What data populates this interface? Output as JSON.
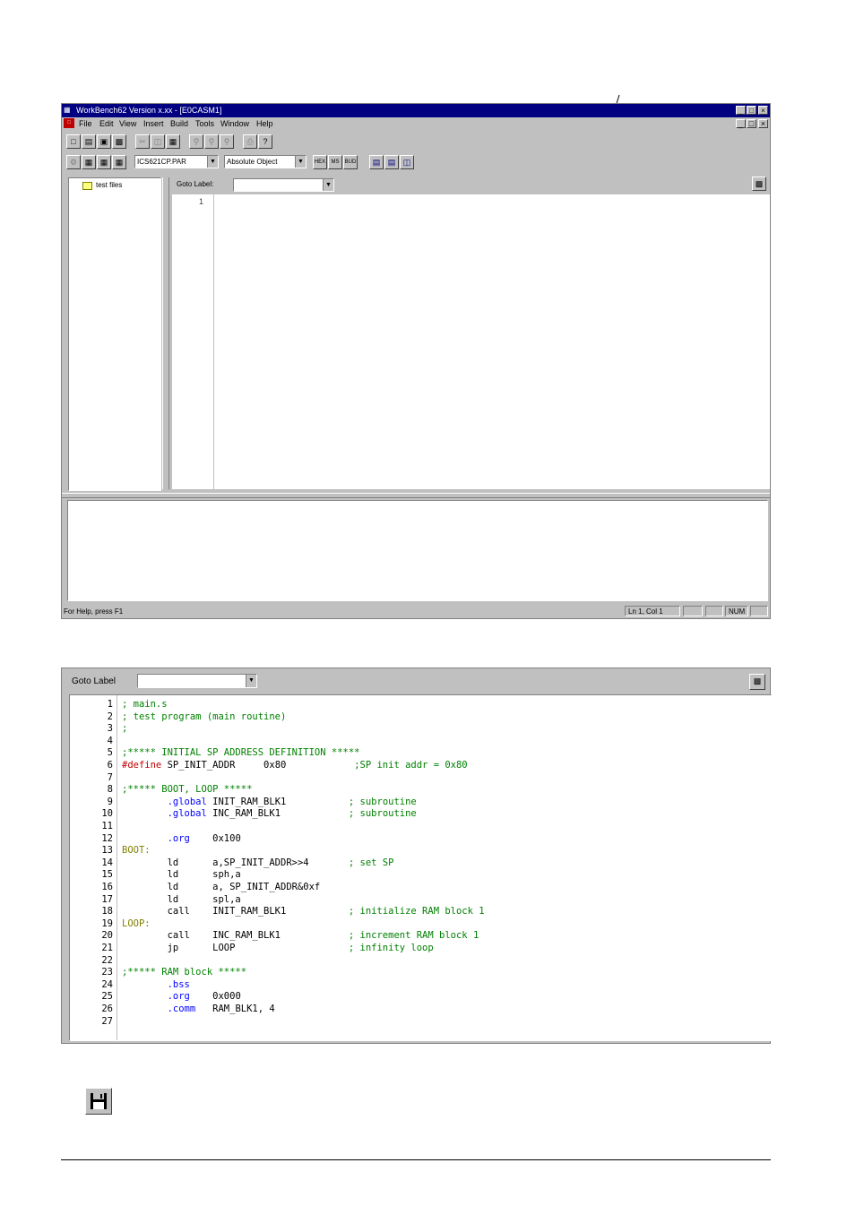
{
  "window1": {
    "title": "WorkBench62  Version x.xx - [E0CASM1]",
    "menu": [
      "File",
      "Edit",
      "View",
      "Insert",
      "Build",
      "Tools",
      "Window",
      "Help"
    ],
    "toolbar2": {
      "parameter_file": "ICS621CP.PAR",
      "build_mode": "Absolute Object"
    },
    "tree": {
      "root": "test files"
    },
    "goto_label": "Goto Label:",
    "editor": {
      "lines": [
        "1"
      ]
    },
    "status": {
      "help": "For Help, press F1",
      "position": "Ln 1, Col 1",
      "num": "NUM"
    }
  },
  "window2": {
    "goto_label": "Goto Label",
    "code": [
      {
        "n": "1",
        "parts": [
          {
            "c": "cm",
            "t": "; main.s"
          }
        ]
      },
      {
        "n": "2",
        "parts": [
          {
            "c": "cm",
            "t": "; test program (main routine)"
          }
        ]
      },
      {
        "n": "3",
        "parts": [
          {
            "c": "cm",
            "t": ";"
          }
        ]
      },
      {
        "n": "4",
        "parts": []
      },
      {
        "n": "5",
        "parts": [
          {
            "c": "cm",
            "t": ";***** INITIAL SP ADDRESS DEFINITION *****"
          }
        ]
      },
      {
        "n": "6",
        "parts": [
          {
            "c": "pp",
            "t": "#define"
          },
          {
            "c": "",
            "t": " SP_INIT_ADDR     0x80            "
          },
          {
            "c": "cm",
            "t": ";SP init addr = 0x80"
          }
        ]
      },
      {
        "n": "7",
        "parts": []
      },
      {
        "n": "8",
        "parts": [
          {
            "c": "cm",
            "t": ";***** BOOT, LOOP *****"
          }
        ]
      },
      {
        "n": "9",
        "parts": [
          {
            "c": "",
            "t": "        "
          },
          {
            "c": "kw",
            "t": ".global"
          },
          {
            "c": "",
            "t": " INIT_RAM_BLK1           "
          },
          {
            "c": "cm",
            "t": "; subroutine"
          }
        ]
      },
      {
        "n": "10",
        "parts": [
          {
            "c": "",
            "t": "        "
          },
          {
            "c": "kw",
            "t": ".global"
          },
          {
            "c": "",
            "t": " INC_RAM_BLK1            "
          },
          {
            "c": "cm",
            "t": "; subroutine"
          }
        ]
      },
      {
        "n": "11",
        "parts": []
      },
      {
        "n": "12",
        "parts": [
          {
            "c": "",
            "t": "        "
          },
          {
            "c": "kw",
            "t": ".org"
          },
          {
            "c": "",
            "t": "    0x100"
          }
        ]
      },
      {
        "n": "13",
        "parts": [
          {
            "c": "lb",
            "t": "BOOT:"
          }
        ]
      },
      {
        "n": "14",
        "parts": [
          {
            "c": "",
            "t": "        ld      a,SP_INIT_ADDR>>4       "
          },
          {
            "c": "cm",
            "t": "; set SP"
          }
        ]
      },
      {
        "n": "15",
        "parts": [
          {
            "c": "",
            "t": "        ld      sph,a"
          }
        ]
      },
      {
        "n": "16",
        "parts": [
          {
            "c": "",
            "t": "        ld      a, SP_INIT_ADDR&0xf"
          }
        ]
      },
      {
        "n": "17",
        "parts": [
          {
            "c": "",
            "t": "        ld      spl,a"
          }
        ]
      },
      {
        "n": "18",
        "parts": [
          {
            "c": "",
            "t": "        call    INIT_RAM_BLK1           "
          },
          {
            "c": "cm",
            "t": "; initialize RAM block 1"
          }
        ]
      },
      {
        "n": "19",
        "parts": [
          {
            "c": "lb",
            "t": "LOOP:"
          }
        ]
      },
      {
        "n": "20",
        "parts": [
          {
            "c": "",
            "t": "        call    INC_RAM_BLK1            "
          },
          {
            "c": "cm",
            "t": "; increment RAM block 1"
          }
        ]
      },
      {
        "n": "21",
        "parts": [
          {
            "c": "",
            "t": "        jp      LOOP                    "
          },
          {
            "c": "cm",
            "t": "; infinity loop"
          }
        ]
      },
      {
        "n": "22",
        "parts": []
      },
      {
        "n": "23",
        "parts": [
          {
            "c": "cm",
            "t": ";***** RAM block *****"
          }
        ]
      },
      {
        "n": "24",
        "parts": [
          {
            "c": "",
            "t": "        "
          },
          {
            "c": "kw",
            "t": ".bss"
          }
        ]
      },
      {
        "n": "25",
        "parts": [
          {
            "c": "",
            "t": "        "
          },
          {
            "c": "kw",
            "t": ".org"
          },
          {
            "c": "",
            "t": "    0x000"
          }
        ]
      },
      {
        "n": "26",
        "parts": [
          {
            "c": "",
            "t": "        "
          },
          {
            "c": "kw",
            "t": ".comm"
          },
          {
            "c": "",
            "t": "   RAM_BLK1, 4"
          }
        ]
      },
      {
        "n": "27",
        "parts": []
      }
    ]
  }
}
